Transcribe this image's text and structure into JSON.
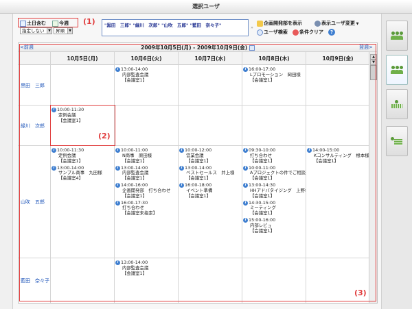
{
  "window": {
    "title": "選択ユーザ"
  },
  "toolbar": {
    "weekend_label": "土日含む",
    "thisweek_label": "今週",
    "filter_select": "指定しない",
    "position_select": "昇順",
    "selected_users": "\"黒田　三郎\" \"緑川　次郎\" \"山吹　五郎\" \"藍田　奈々子\"",
    "actions": {
      "show_planning": "企画開発部を表示",
      "change_users": "表示ユーザ変更",
      "user_search": "ユーザ検索",
      "clear_conditions": "条件クリア"
    }
  },
  "annotations": {
    "a1": "(1)",
    "a2": "(2)",
    "a3": "(3)"
  },
  "calendar": {
    "prev_label": "<前週",
    "next_label": "翌週>",
    "range_title": "2009年10月5日(月) - 2009年10月9日(金)",
    "days": [
      "10月5日(月)",
      "10月6日(火)",
      "10月7日(水)",
      "10月8日(木)",
      "10月9日(金)"
    ],
    "rows": [
      {
        "user": "黒田　三郎",
        "days": [
          [],
          [
            {
              "time": "13:00-14:00",
              "title": "内部監査会議",
              "room": "【会議室1】"
            }
          ],
          [],
          [
            {
              "time": "16:00-17:00",
              "title": "Lプロモーション　岡田様",
              "room": "【会議室1】"
            }
          ],
          []
        ]
      },
      {
        "user": "緑川　次郎",
        "days": [
          [
            {
              "time": "10:00-11:30",
              "title": "定例会議",
              "room": "【会議室1】"
            }
          ],
          [],
          [],
          [],
          []
        ]
      },
      {
        "user": "山吹　五郎",
        "days": [
          [
            {
              "time": "10:00-11:30",
              "title": "定例会議",
              "room": "【会議室1】"
            },
            {
              "time": "13:00-14:00",
              "title": "サンプル商事　九田様",
              "room": "【会議室4】"
            }
          ],
          [
            {
              "time": "10:00-11:00",
              "title": "N商事　原田様",
              "room": "【会議室1】"
            },
            {
              "time": "13:00-14:00",
              "title": "内部監査会議",
              "room": "【会議室1】"
            },
            {
              "time": "14:00-16:00",
              "title": "企画開発部　打ち合わせ",
              "room": "【会議室1】"
            },
            {
              "time": "16:00-17:30",
              "title": "打ち合わせ",
              "room": "【会議室未指定】"
            }
          ],
          [
            {
              "time": "10:00-12:00",
              "title": "営業会議",
              "room": "【会議室1】"
            },
            {
              "time": "13:00-14:00",
              "title": "ベストセールス　井上様",
              "room": "【会議室1】"
            },
            {
              "time": "16:00-18:00",
              "title": "イベント準備",
              "room": "【会議室1】"
            }
          ],
          [
            {
              "time": "09:30-10:00",
              "title": "打ち合わせ",
              "room": "【会議室1】"
            },
            {
              "time": "10:00-11:00",
              "title": "Aプロジェクトの件でご相談",
              "room": "【会議室1】"
            },
            {
              "time": "13:00-14:30",
              "title": "HHアドバタイジング　上野様",
              "room": "【会議室1】"
            },
            {
              "time": "14:30-15:00",
              "title": "ミーティング",
              "room": "【会議室1】"
            },
            {
              "time": "15:00-16:00",
              "title": "内部レビュ",
              "room": "【会議室1】"
            }
          ],
          [
            {
              "time": "14:00-15:00",
              "title": "Kコンサルティング　根本様",
              "room": "【会議室1】"
            }
          ]
        ]
      },
      {
        "user": "藍田　奈々子",
        "days": [
          [],
          [
            {
              "time": "13:00-14:00",
              "title": "内部監査会議",
              "room": "【会議室1】"
            }
          ],
          [],
          [],
          []
        ]
      }
    ]
  }
}
